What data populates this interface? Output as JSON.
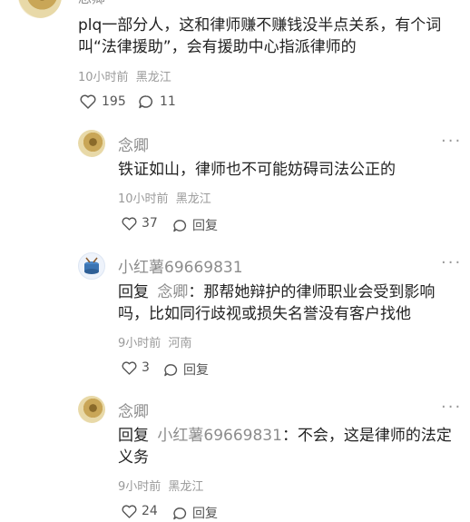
{
  "top_comment": {
    "author_partial": "念卿",
    "text_line1": "plq一部分人，这和律师赚不赚钱没半点关系，有个词",
    "text_line2": "叫“法律援助”，会有援助中心指派律师的",
    "time": "10小时前",
    "location": "黑龙江",
    "likes": "195",
    "comments": "11"
  },
  "replies": [
    {
      "author": "念卿",
      "text_line1": "铁证如山，律师也不可能妨碍司法公正的",
      "time": "10小时前",
      "location": "黑龙江",
      "likes": "37",
      "reply_label": "回复",
      "avatar_icon": "gold-emblem-avatar"
    },
    {
      "author": "小红薯69669831",
      "reply_prefix": "回复",
      "mention": "念卿",
      "text_line1_rest": "：那帮她辩护的律师职业会受到影响",
      "text_line2": "吗，比如同行歧视或损失名誉没有客户找他",
      "time": "9小时前",
      "location": "河南",
      "likes": "3",
      "reply_label": "回复",
      "avatar_icon": "drum-avatar"
    },
    {
      "author": "念卿",
      "reply_prefix": "回复",
      "mention": "小红薯69669831",
      "text_line1_rest": "：不会，这是律师的法定",
      "text_line2": "义务",
      "time": "9小时前",
      "location": "黑龙江",
      "likes": "24",
      "reply_label": "回复",
      "avatar_icon": "gold-emblem-avatar"
    }
  ],
  "more_glyph": "···"
}
